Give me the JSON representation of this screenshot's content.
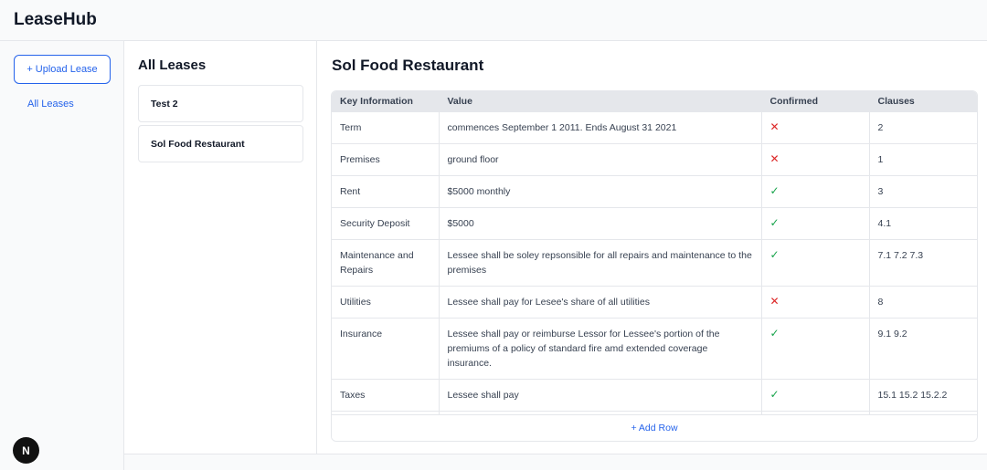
{
  "app": {
    "title": "LeaseHub"
  },
  "sidebar": {
    "upload_label": "+ Upload Lease",
    "nav": [
      {
        "label": "All Leases"
      }
    ]
  },
  "lease_list": {
    "title": "All Leases",
    "items": [
      {
        "name": "Test 2"
      },
      {
        "name": "Sol Food Restaurant"
      }
    ]
  },
  "detail": {
    "title": "Sol Food Restaurant",
    "columns": [
      "Key Information",
      "Value",
      "Confirmed",
      "Clauses"
    ],
    "rows": [
      {
        "key": "Term",
        "value": "commences September 1 2011. Ends August 31 2021",
        "confirmed": "✕",
        "clauses": "2"
      },
      {
        "key": "Premises",
        "value": "ground floor",
        "confirmed": "✕",
        "clauses": "1"
      },
      {
        "key": "Rent",
        "value": "$5000 monthly",
        "confirmed": "✓",
        "clauses": "3"
      },
      {
        "key": "Security Deposit",
        "value": "$5000",
        "confirmed": "✓",
        "clauses": "4.1"
      },
      {
        "key": "Maintenance and Repairs",
        "value": "Lessee shall be soley repsonsible for all repairs and maintenance to the premises",
        "confirmed": "✓",
        "clauses": "7.1 7.2 7.3"
      },
      {
        "key": "Utilities",
        "value": "Lessee shall pay for Lesee's share of all utilities",
        "confirmed": "✕",
        "clauses": "8"
      },
      {
        "key": "Insurance",
        "value": "Lessee shall pay or reimburse Lessor for Lessee's portion of the premiums of a policy of standard fire amd extended coverage insurance.",
        "confirmed": "✓",
        "clauses": "9.1 9.2"
      },
      {
        "key": "Taxes",
        "value": "Lessee shall pay",
        "confirmed": "✓",
        "clauses": "15.1 15.2 15.2.2"
      },
      {
        "key": "",
        "value": "",
        "confirmed": "",
        "clauses": ""
      }
    ],
    "add_row_label": "+ Add Row"
  },
  "badge": {
    "label": "N"
  },
  "colors": {
    "accent": "#2563eb",
    "confirmed_yes": "#16a34a",
    "confirmed_no": "#dc2626",
    "header_bg": "#e5e7eb"
  }
}
